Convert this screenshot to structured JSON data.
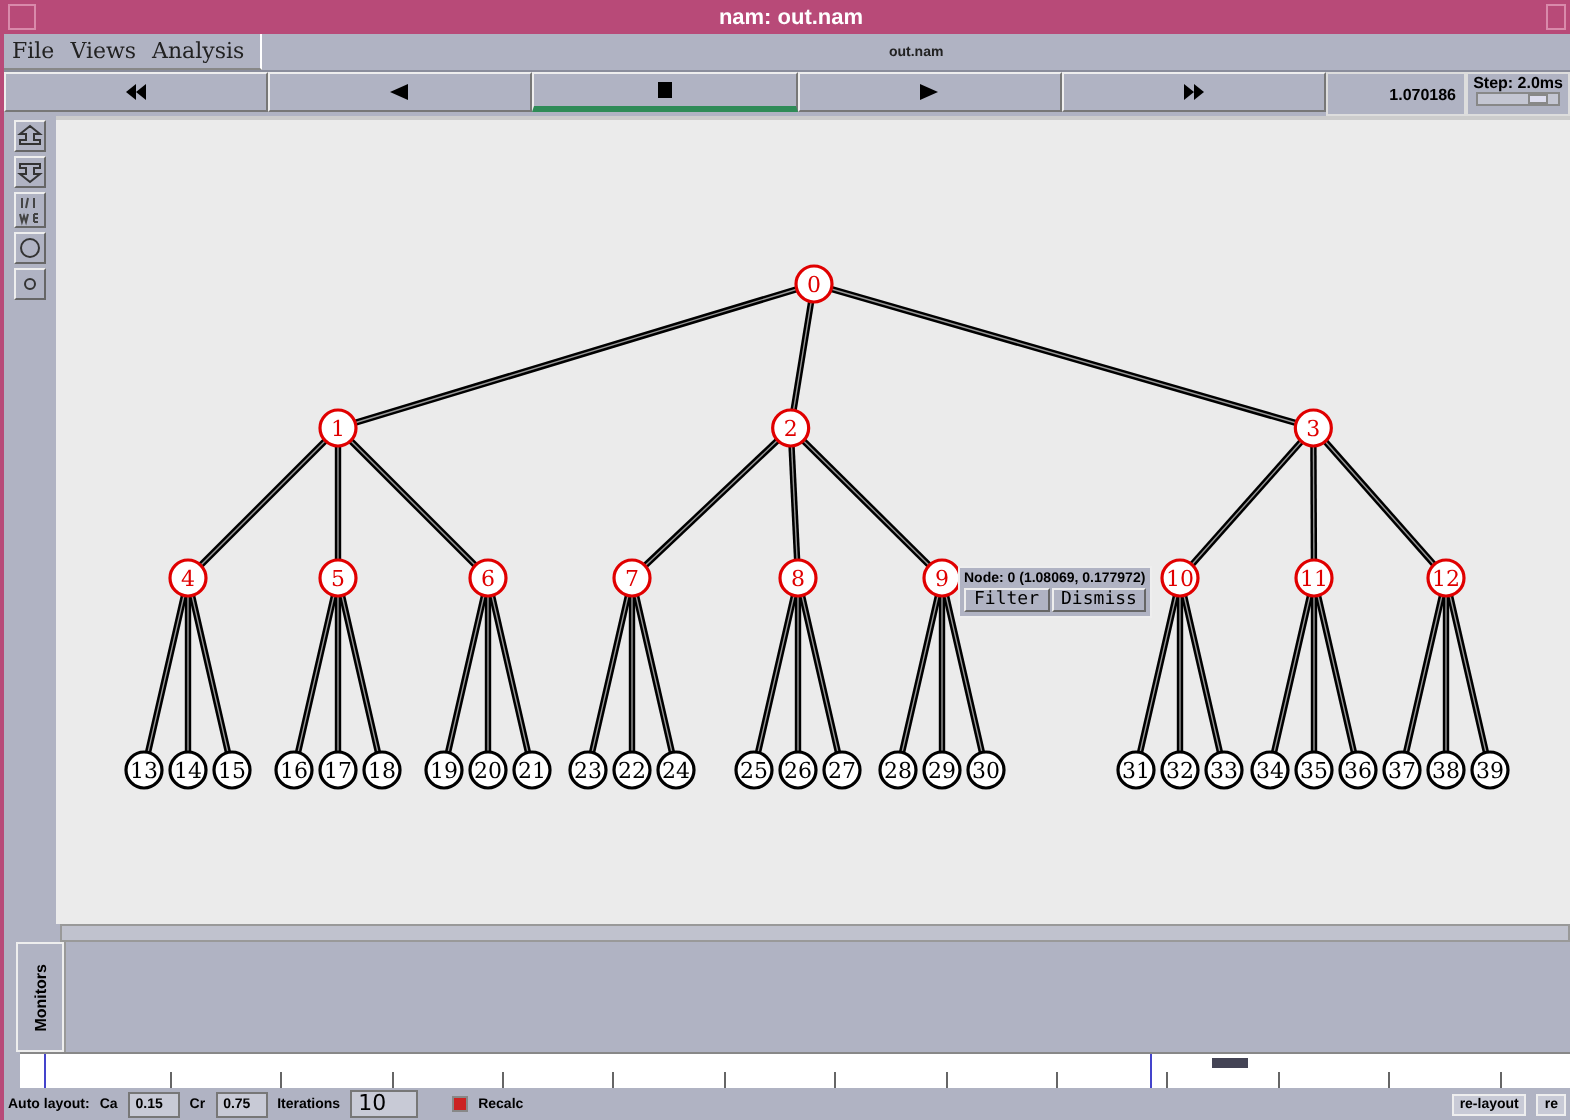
{
  "window": {
    "title": "nam: out.nam"
  },
  "menu": [
    {
      "label": "File"
    },
    {
      "label": "Views"
    },
    {
      "label": "Analysis"
    }
  ],
  "file_name": "out.nam",
  "playback": [
    {
      "kind": "rewind",
      "selected": false
    },
    {
      "kind": "back",
      "selected": false
    },
    {
      "kind": "stop",
      "selected": true
    },
    {
      "kind": "play",
      "selected": false
    },
    {
      "kind": "forward",
      "selected": false
    }
  ],
  "time": "1.070186",
  "step": {
    "label": "Step: 2.0ms",
    "level": 0.75
  },
  "tools": [
    {
      "kind": "zoom-in"
    },
    {
      "kind": "zoom-out"
    },
    {
      "kind": "edit"
    },
    {
      "kind": "ring"
    },
    {
      "kind": "dot"
    }
  ],
  "tree": {
    "label": "0",
    "color": "#e00000",
    "children": [
      {
        "label": "1",
        "color": "#e00000",
        "children": [
          {
            "label": "4",
            "color": "#e00000",
            "children": [
              {
                "label": "13",
                "color": "#000000"
              },
              {
                "label": "14",
                "color": "#000000"
              },
              {
                "label": "15",
                "color": "#000000"
              }
            ]
          },
          {
            "label": "5",
            "color": "#e00000",
            "children": [
              {
                "label": "16",
                "color": "#000000"
              },
              {
                "label": "17",
                "color": "#000000"
              },
              {
                "label": "18",
                "color": "#000000"
              }
            ]
          },
          {
            "label": "6",
            "color": "#e00000",
            "children": [
              {
                "label": "19",
                "color": "#000000"
              },
              {
                "label": "20",
                "color": "#000000"
              },
              {
                "label": "21",
                "color": "#000000"
              }
            ]
          }
        ]
      },
      {
        "label": "2",
        "color": "#e00000",
        "children": [
          {
            "label": "7",
            "color": "#e00000",
            "children": [
              {
                "label": "23",
                "color": "#000000"
              },
              {
                "label": "22",
                "color": "#000000"
              },
              {
                "label": "24",
                "color": "#000000"
              }
            ]
          },
          {
            "label": "8",
            "color": "#e00000",
            "children": [
              {
                "label": "25",
                "color": "#000000"
              },
              {
                "label": "26",
                "color": "#000000"
              },
              {
                "label": "27",
                "color": "#000000"
              }
            ]
          },
          {
            "label": "9",
            "color": "#e00000",
            "children": [
              {
                "label": "28",
                "color": "#000000"
              },
              {
                "label": "29",
                "color": "#000000"
              },
              {
                "label": "30",
                "color": "#000000"
              }
            ]
          }
        ]
      },
      {
        "label": "3",
        "color": "#e00000",
        "children": [
          {
            "label": "10",
            "color": "#e00000",
            "children": [
              {
                "label": "31",
                "color": "#000000"
              },
              {
                "label": "32",
                "color": "#000000"
              },
              {
                "label": "33",
                "color": "#000000"
              }
            ]
          },
          {
            "label": "11",
            "color": "#e00000",
            "children": [
              {
                "label": "34",
                "color": "#000000"
              },
              {
                "label": "35",
                "color": "#000000"
              },
              {
                "label": "36",
                "color": "#000000"
              }
            ]
          },
          {
            "label": "12",
            "color": "#e00000",
            "children": [
              {
                "label": "37",
                "color": "#000000"
              },
              {
                "label": "38",
                "color": "#000000"
              },
              {
                "label": "39",
                "color": "#000000"
              }
            ]
          }
        ]
      }
    ]
  },
  "popup": {
    "text": "Node: 0 (1.08069, 0.177972)",
    "buttons": [
      "Filter",
      "Dismiss"
    ]
  },
  "monitors_label": "Monitors",
  "layout_bar": {
    "label": "Auto layout:",
    "ca_label": "Ca",
    "ca": "0.15",
    "cr_label": "Cr",
    "cr": "0.75",
    "iterations_label": "Iterations",
    "iterations": "10",
    "recalc": {
      "label": "Recalc",
      "checked": true
    },
    "buttons": [
      "re-layout",
      "re"
    ]
  }
}
